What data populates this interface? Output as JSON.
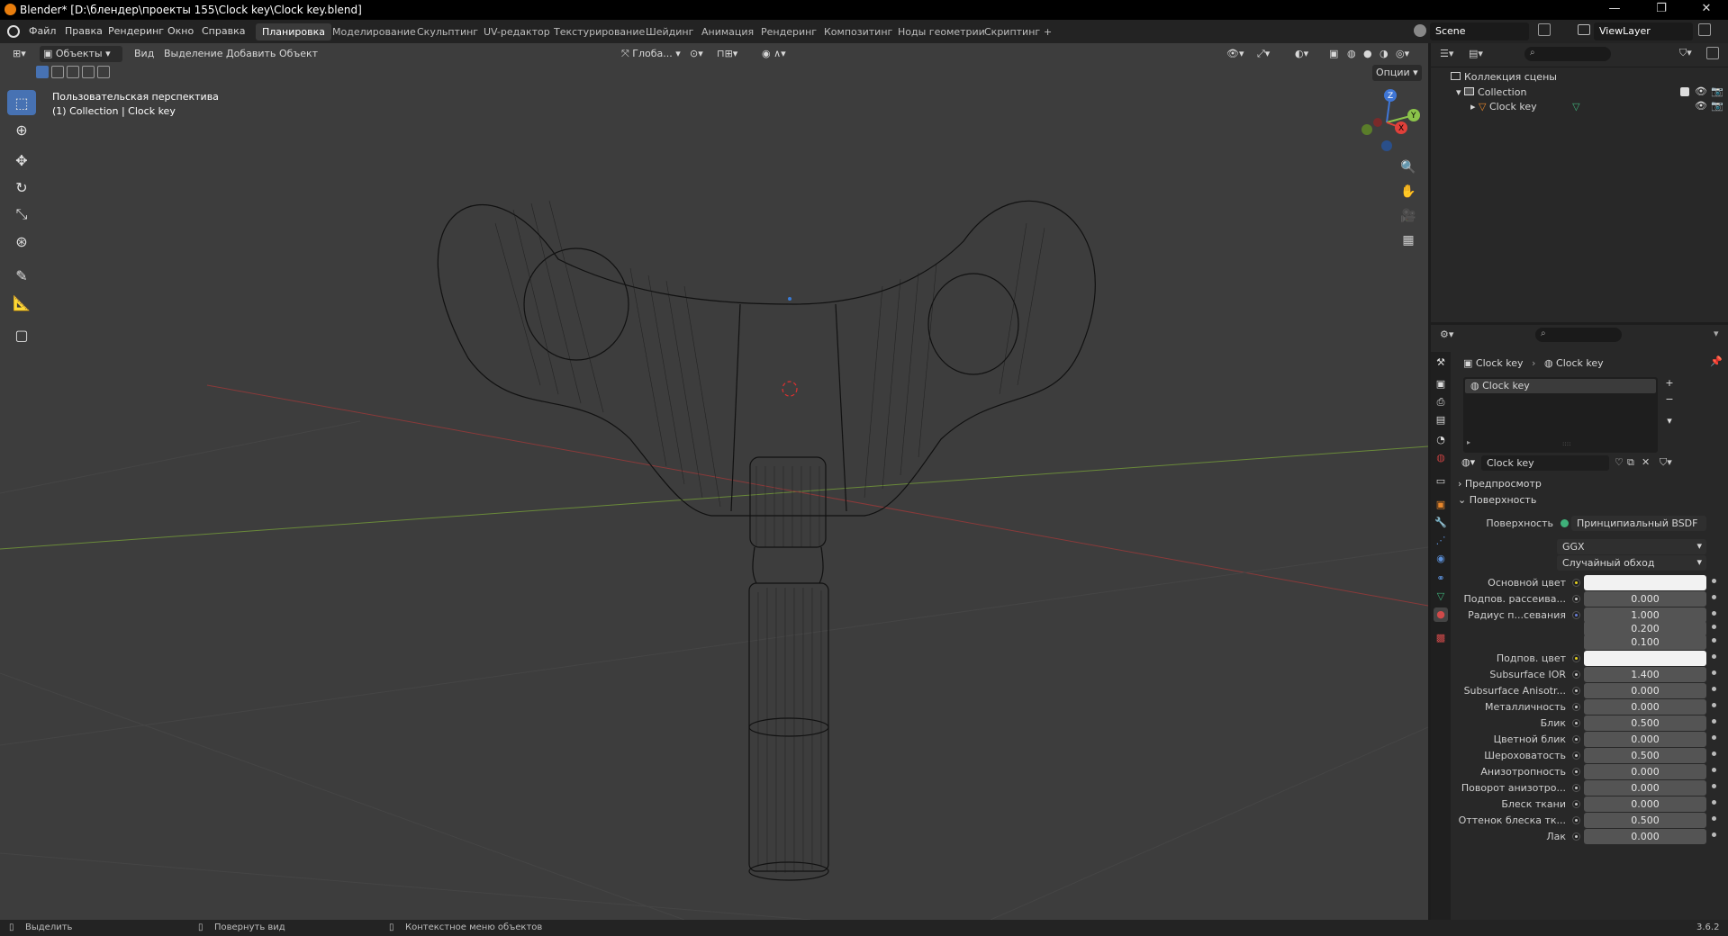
{
  "window": {
    "title": "Blender* [D:\\блендер\\проекты 155\\Clock key\\Clock key.blend]",
    "minimize": "—",
    "maximize": "❐",
    "close": "✕"
  },
  "menu": [
    "Файл",
    "Правка",
    "Рендеринг",
    "Окно",
    "Справка"
  ],
  "workspaces": [
    "Планировка",
    "Моделирование",
    "Скульптинг",
    "UV-редактор",
    "Текстурирование",
    "Шейдинг",
    "Анимация",
    "Рендеринг",
    "Композитинг",
    "Ноды геометрии",
    "Скриптинг",
    "+"
  ],
  "active_workspace": "Планировка",
  "scene": {
    "name": "Scene",
    "view_layer": "ViewLayer"
  },
  "viewport": {
    "mode": "Объекты",
    "menus": [
      "Вид",
      "Выделение",
      "Добавить",
      "Объект"
    ],
    "transform_orientation": "Глоба...",
    "options": "Опции",
    "overlay_line1": "Пользовательская перспектива",
    "overlay_line2": "(1) Collection | Clock key",
    "gizmo": {
      "z": "Z",
      "y": "Y",
      "x": "X"
    }
  },
  "outliner": {
    "root": "Коллекция сцены",
    "collection": "Collection",
    "object": "Clock key"
  },
  "properties": {
    "breadcrumb_object": "Clock key",
    "breadcrumb_material": "Clock key",
    "material_slot": "Clock key",
    "material_name": "Clock key",
    "section_preview": "Предпросмотр",
    "section_surface": "Поверхность",
    "surface_label": "Поверхность",
    "surface_value": "Принципиальный BSDF",
    "distribution": "GGX",
    "subsurface_method": "Случайный обход",
    "rows": [
      {
        "label": "Основной цвет",
        "value": "",
        "kind": "color",
        "dot": "yel"
      },
      {
        "label": "Подпов. рассеива...",
        "value": "0.000",
        "kind": "num",
        "fill": 0
      },
      {
        "label": "Радиус п...севания",
        "value": "1.000",
        "kind": "num",
        "fill": 0,
        "dot": "blu"
      },
      {
        "label": "",
        "value": "0.200",
        "kind": "num",
        "fill": 0
      },
      {
        "label": "",
        "value": "0.100",
        "kind": "num",
        "fill": 0
      },
      {
        "label": "Подпов. цвет",
        "value": "",
        "kind": "color",
        "dot": "yel"
      },
      {
        "label": "Subsurface IOR",
        "value": "1.400",
        "kind": "num",
        "fill": 0.1
      },
      {
        "label": "Subsurface Anisotr...",
        "value": "0.000",
        "kind": "num",
        "fill": 0
      },
      {
        "label": "Металличность",
        "value": "0.000",
        "kind": "num",
        "fill": 0
      },
      {
        "label": "Блик",
        "value": "0.500",
        "kind": "num",
        "fill": 0.5
      },
      {
        "label": "Цветной блик",
        "value": "0.000",
        "kind": "num",
        "fill": 0
      },
      {
        "label": "Шероховатость",
        "value": "0.500",
        "kind": "num",
        "fill": 0.5
      },
      {
        "label": "Анизотропность",
        "value": "0.000",
        "kind": "num",
        "fill": 0
      },
      {
        "label": "Поворот анизотро...",
        "value": "0.000",
        "kind": "num",
        "fill": 0
      },
      {
        "label": "Блеск ткани",
        "value": "0.000",
        "kind": "num",
        "fill": 0
      },
      {
        "label": "Оттенок блеска тк...",
        "value": "0.500",
        "kind": "num",
        "fill": 0.5
      },
      {
        "label": "Лак",
        "value": "0.000",
        "kind": "num",
        "fill": 0
      }
    ]
  },
  "status": {
    "left": "Выделить",
    "middle": "Повернуть вид",
    "right": "Контекстное меню объектов",
    "version": "3.6.2"
  },
  "colors": {
    "accent": "#4772b3",
    "viewport_bg": "#3d3d3d",
    "panel_bg": "#282828"
  }
}
